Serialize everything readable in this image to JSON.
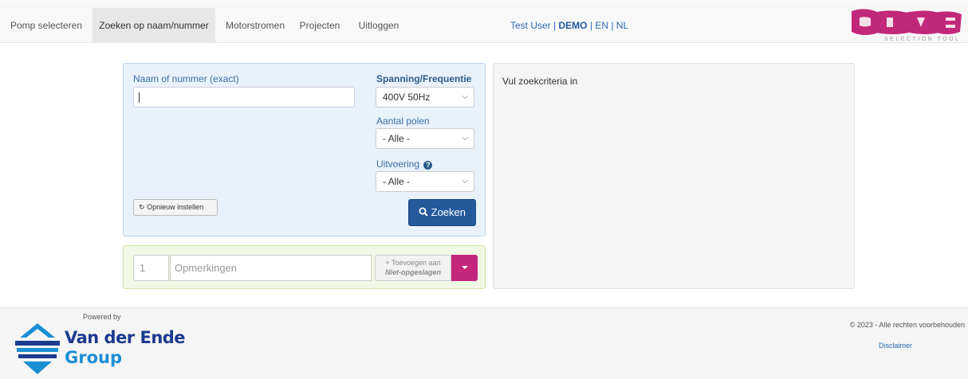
{
  "nav": {
    "items": [
      "Pomp selecteren",
      "Zoeken op naam/nummer",
      "Motorstromen",
      "Projecten",
      "Uitloggen"
    ],
    "active_index": 1
  },
  "user_bar": {
    "user": "Test User",
    "sep": "|",
    "mode": "DEMO",
    "lang_en": "EN",
    "lang_nl": "NL"
  },
  "logo": {
    "word": "CURVES",
    "subtitle": "SELECTION TOOL",
    "color": "#c2287a"
  },
  "search": {
    "name_label": "Naam of nummer (exact)",
    "name_value": "",
    "voltage_label": "Spanning/Frequentie",
    "voltage_value": "400V 50Hz",
    "poles_label": "Aantal polen",
    "poles_value": "- Alle -",
    "execution_label": "Uitvoering",
    "execution_value": "- Alle -",
    "reset_label": "Opnieuw instellen",
    "search_label": "Zoeken",
    "colors": {
      "panel_bg": "#e9f2fb",
      "search_button": "#245a9c"
    }
  },
  "remarks": {
    "quantity": "1",
    "placeholder": "Opmerkingen",
    "add_label": "Toevoegen aan",
    "add_target": "Niet-opgeslagen",
    "dropdown_color": "#c3267a"
  },
  "results": {
    "message": "Vul zoekcriteria in"
  },
  "footer": {
    "powered_by": "Powered by",
    "brand_line1": "Van der Ende",
    "brand_line2": "Group",
    "copyright": "© 2023 - Alle rechten voorbehouden",
    "disclaimer": "Disclaimer"
  }
}
